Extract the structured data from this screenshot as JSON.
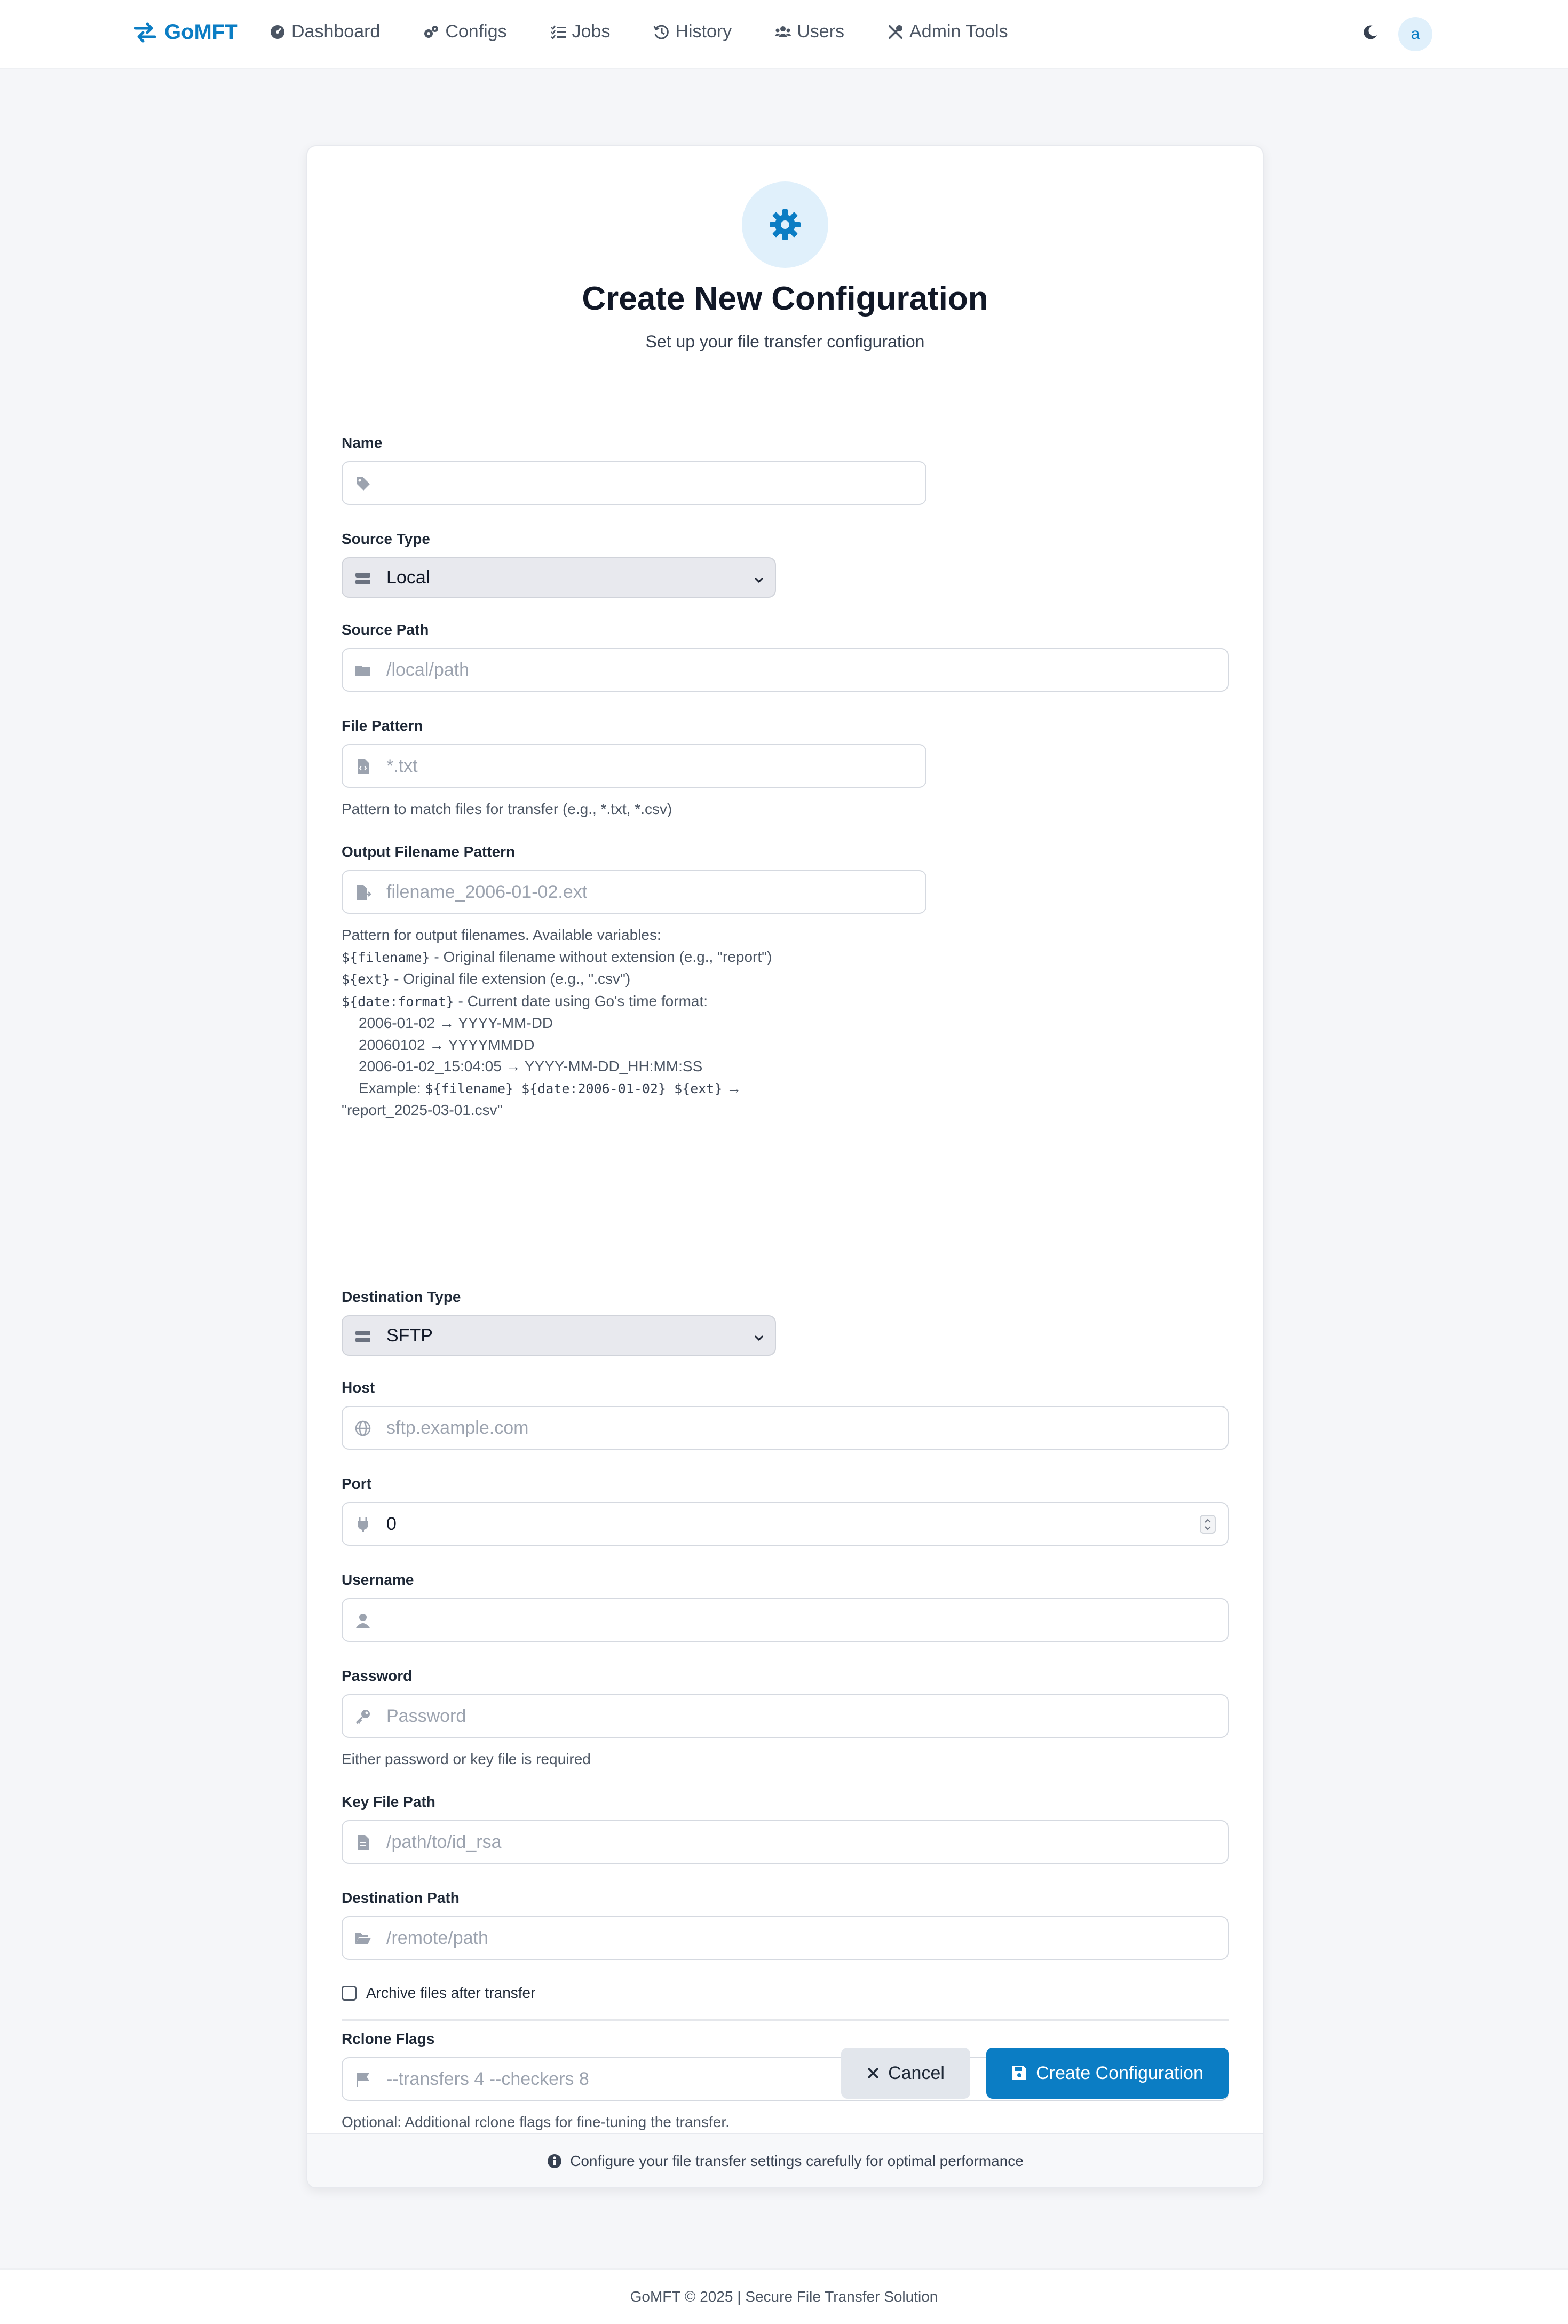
{
  "app": {
    "brand": "GoMFT",
    "user_initial": "a"
  },
  "nav": {
    "items": [
      {
        "label": "Dashboard",
        "icon": "gauge-icon"
      },
      {
        "label": "Configs",
        "icon": "cogs-icon"
      },
      {
        "label": "Jobs",
        "icon": "list-check-icon"
      },
      {
        "label": "History",
        "icon": "history-icon"
      },
      {
        "label": "Users",
        "icon": "users-icon"
      },
      {
        "label": "Admin Tools",
        "icon": "tools-icon"
      }
    ]
  },
  "page": {
    "title": "Create New Configuration",
    "subtitle": "Set up your file transfer configuration"
  },
  "form": {
    "name": {
      "label": "Name",
      "value": "",
      "placeholder": ""
    },
    "source_type": {
      "label": "Source Type",
      "value": "Local"
    },
    "source_path": {
      "label": "Source Path",
      "placeholder": "/local/path"
    },
    "file_pattern": {
      "label": "File Pattern",
      "placeholder": "*.txt",
      "help": "Pattern to match files for transfer (e.g., *.txt, *.csv)"
    },
    "output_pattern": {
      "label": "Output Filename Pattern",
      "placeholder": "filename_2006-01-02.ext",
      "help_intro": "Pattern for output filenames. Available variables:",
      "var_filename_code": "${filename}",
      "var_filename_desc": " - Original filename without extension (e.g., \"report\")",
      "var_ext_code": "${ext}",
      "var_ext_desc": " - Original file extension (e.g., \".csv\")",
      "var_date_code": "${date:format}",
      "var_date_desc": " - Current date using Go's time format:",
      "fmt1": "2006-01-02 → YYYY-MM-DD",
      "fmt2": "20060102 → YYYYMMDD",
      "fmt3": "2006-01-02_15:04:05 → YYYY-MM-DD_HH:MM:SS",
      "example_prefix": "Example: ",
      "example_code": "${filename}_${date:2006-01-02}_${ext}",
      "example_arrow": " →",
      "example_result": "\"report_2025-03-01.csv\""
    },
    "destination_type": {
      "label": "Destination Type",
      "value": "SFTP"
    },
    "host": {
      "label": "Host",
      "placeholder": "sftp.example.com"
    },
    "port": {
      "label": "Port",
      "value": "0"
    },
    "username": {
      "label": "Username",
      "value": ""
    },
    "password": {
      "label": "Password",
      "placeholder": "Password",
      "help": "Either password or key file is required"
    },
    "key_file": {
      "label": "Key File Path",
      "placeholder": "/path/to/id_rsa"
    },
    "destination_path": {
      "label": "Destination Path",
      "placeholder": "/remote/path"
    },
    "archive": {
      "label": "Archive files after transfer",
      "checked": false
    },
    "rclone_flags": {
      "label": "Rclone Flags",
      "placeholder": "--transfers 4 --checkers 8",
      "help": "Optional: Additional rclone flags for fine-tuning the transfer."
    }
  },
  "actions": {
    "cancel": "Cancel",
    "create": "Create Configuration"
  },
  "card_footer": "Configure your file transfer settings carefully for optimal performance",
  "page_footer": "GoMFT © 2025 | Secure File Transfer Solution",
  "colors": {
    "accent": "#0b7dc4",
    "accent_light": "#e0f0fb",
    "muted": "#9ca3af"
  }
}
